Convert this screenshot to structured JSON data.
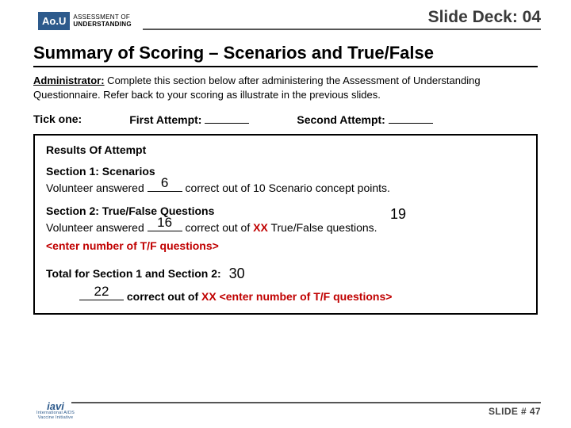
{
  "header": {
    "logo_abbrev": "Ao.U",
    "logo_line1": "ASSESSMENT OF",
    "logo_line2": "UNDERSTANDING",
    "deck_label": "Slide Deck: 04"
  },
  "title": "Summary of Scoring – Scenarios and True/False",
  "instruction": {
    "label": "Administrator:",
    "text": " Complete this section below after administering the Assessment of Understanding Questionnaire. Refer back to your scoring as illustrate in the previous slides."
  },
  "tick": {
    "label": "Tick one:",
    "first": "First Attempt:",
    "second": "Second Attempt:"
  },
  "box": {
    "title": "Results Of Attempt",
    "sec1_hd": "Section 1: Scenarios",
    "sec1_lead": "Volunteer answered ",
    "sec1_val": "6",
    "sec1_tail": " correct out of 10 Scenario concept points.",
    "sec2_hd": "Section 2: True/False Questions",
    "sec2_lead": "Volunteer answered ",
    "sec2_val": "16",
    "sec2_mid": " correct out of ",
    "sec2_xx": "XX",
    "sec2_tail": " True/False questions.",
    "sec2_float": "19",
    "sec2_placeholder": "<enter number of T/F questions>",
    "total_label": "Total for Section 1 and Section 2:",
    "total_val": "30",
    "final_val": "22",
    "final_mid": " correct out of ",
    "final_xx": "XX",
    "final_placeholder": " <enter number of T/F questions>"
  },
  "footer": {
    "org": "iavi",
    "org_sub1": "International AIDS",
    "org_sub2": "Vaccine Initiative",
    "slide": "SLIDE # 47"
  }
}
